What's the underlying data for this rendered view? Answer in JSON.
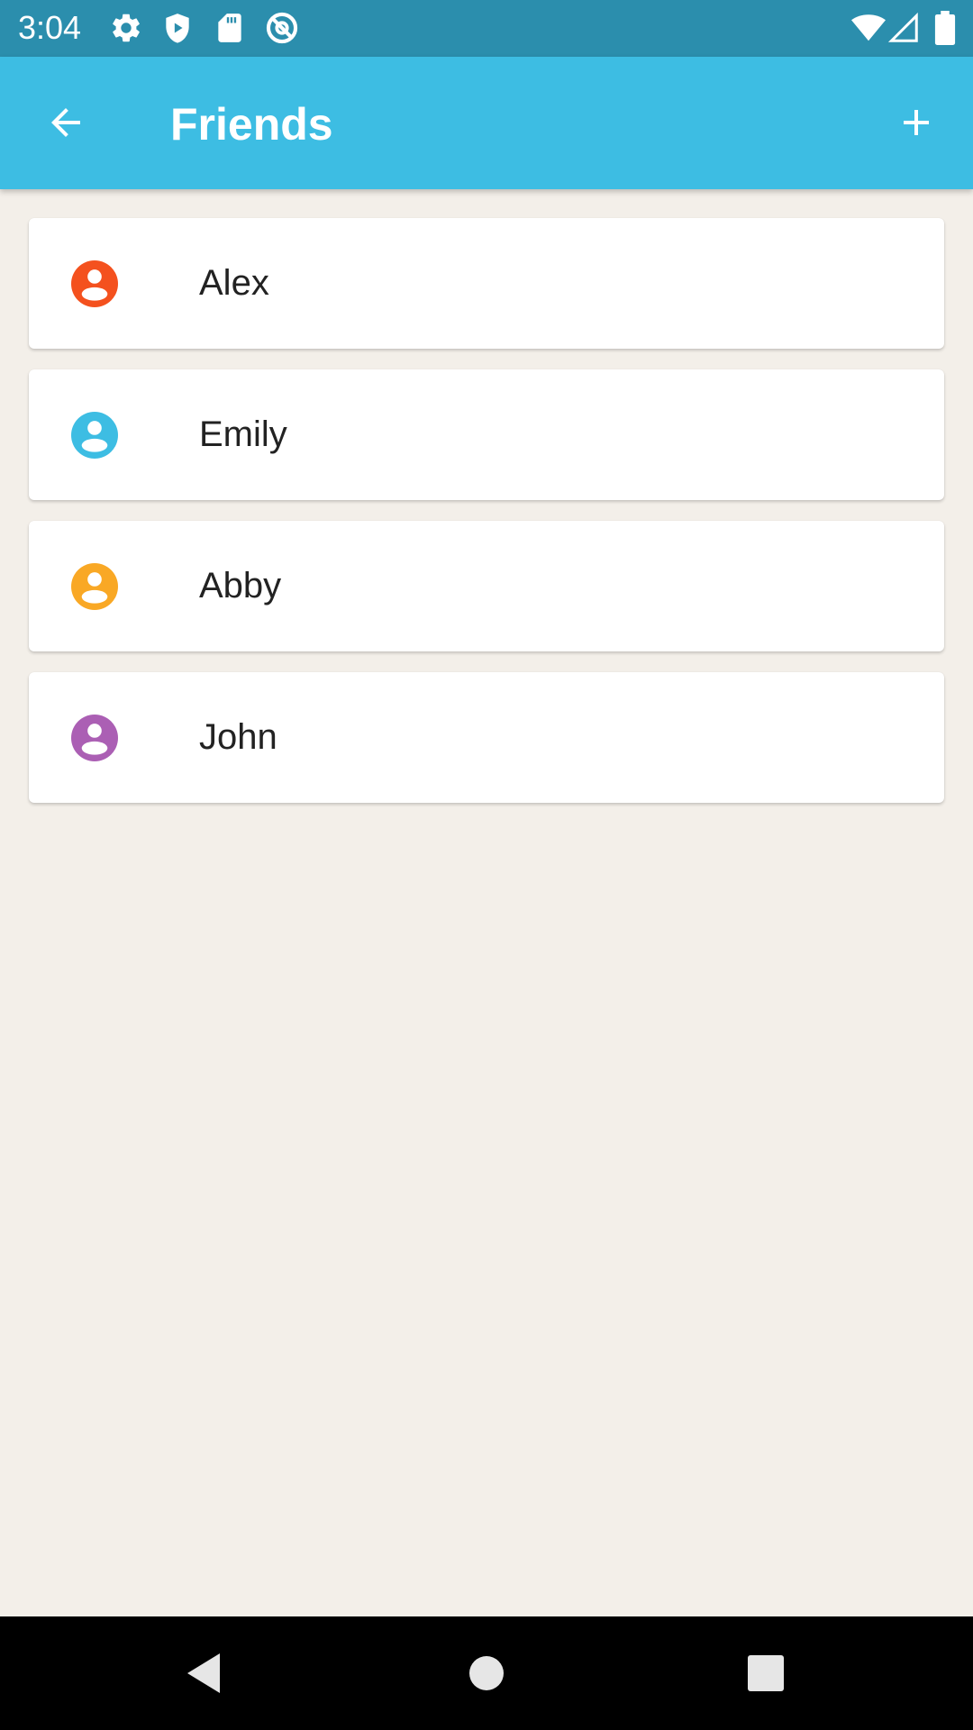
{
  "status_bar": {
    "time": "3:04",
    "left_icons": [
      "gear-icon",
      "shield-play-icon",
      "sd-card-icon",
      "at-sign-icon"
    ],
    "right_icons": [
      "wifi-icon",
      "signal-icon",
      "battery-icon"
    ]
  },
  "app_bar": {
    "title": "Friends",
    "back_icon": "arrow-back-icon",
    "add_icon": "plus-icon",
    "color": "#3DBDE3"
  },
  "friends": [
    {
      "name": "Alex",
      "avatar_color": "#F4511E"
    },
    {
      "name": "Emily",
      "avatar_color": "#3DBDE3"
    },
    {
      "name": "Abby",
      "avatar_color": "#F9A825"
    },
    {
      "name": "John",
      "avatar_color": "#AB5FB4"
    }
  ],
  "nav_bar": {
    "buttons": [
      "back-triangle-icon",
      "home-circle-icon",
      "recents-square-icon"
    ]
  },
  "colors": {
    "status_bar": "#2B8EAD",
    "background": "#F3EFE9",
    "card": "#FFFFFF",
    "text": "#222222"
  }
}
